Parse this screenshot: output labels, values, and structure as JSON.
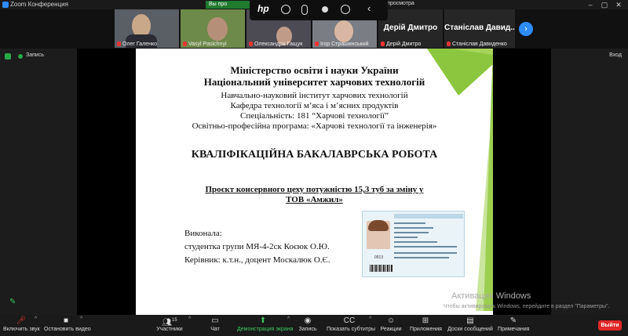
{
  "window": {
    "title": "Zoom Конференция"
  },
  "hp_tab": "Вы про",
  "view_tab": "з просмотра",
  "video_tiles": [
    {
      "name": "Олег Галенко"
    },
    {
      "name": "Vasyl Pasichnyi"
    },
    {
      "name": "Олександра Гащук"
    },
    {
      "name": "Ігор Страшинський"
    },
    {
      "name": "Дерій Дмитро",
      "display": "Дерій Дмитро"
    },
    {
      "name": "Станіслав Давиденко",
      "display": "Станіслав Давид..."
    }
  ],
  "status": {
    "recording_label": "Запись",
    "exit_label": "Вход"
  },
  "slide": {
    "line1": "Міністерство освіти і науки України",
    "line2": "Національний університет харчових технологій",
    "line3": "Навчально-науковий інститут харчових технологій",
    "line4": "Кафедра технології м’яса і м’ясних продуктів",
    "line5": "Спеціальність: 181 “Харчові технології”",
    "line6": "Освітньо-професійна програма: «Харчові технології та інженерія»",
    "heading": "КВАЛІФІКАЦІЙНА БАКАЛАВРСЬКА РОБОТА",
    "project_line1": "Проєкт консервного цеху потужністю 15,3 туб за зміну у",
    "project_line2": "ТОВ «Амжил»",
    "done_by": "Виконала:",
    "student": "студентка групи МЯ-4-2ск Коєюк О.Ю.",
    "supervisor": "Керівник: к.т.н., доцент Москалюк О.Є."
  },
  "id_card": {
    "header": "Національний університет харчових технологій",
    "name1": "Коєюк",
    "name2": "Ольга Юріївна",
    "number": "0913"
  },
  "watermark": {
    "line1": "Активация Windows",
    "line2": "Чтобы активировать Windows, перейдите в раздел \"Параметры\"."
  },
  "toolbar": {
    "mute": "Включить звук",
    "video": "Остановить видео",
    "participants": "Участники",
    "participants_count": "15",
    "chat": "Чат",
    "share": "Демонстрация экрана",
    "record": "Запись",
    "captions": "Показать субтитры",
    "reactions": "Реакции",
    "apps": "Приложения",
    "whiteboard": "Доски сообщений",
    "notes": "Примечания",
    "leave": "Выйти"
  },
  "colors": {
    "accent_green": "#3ec860",
    "leave_red": "#e02828",
    "slide_green": "#8cc63f"
  }
}
